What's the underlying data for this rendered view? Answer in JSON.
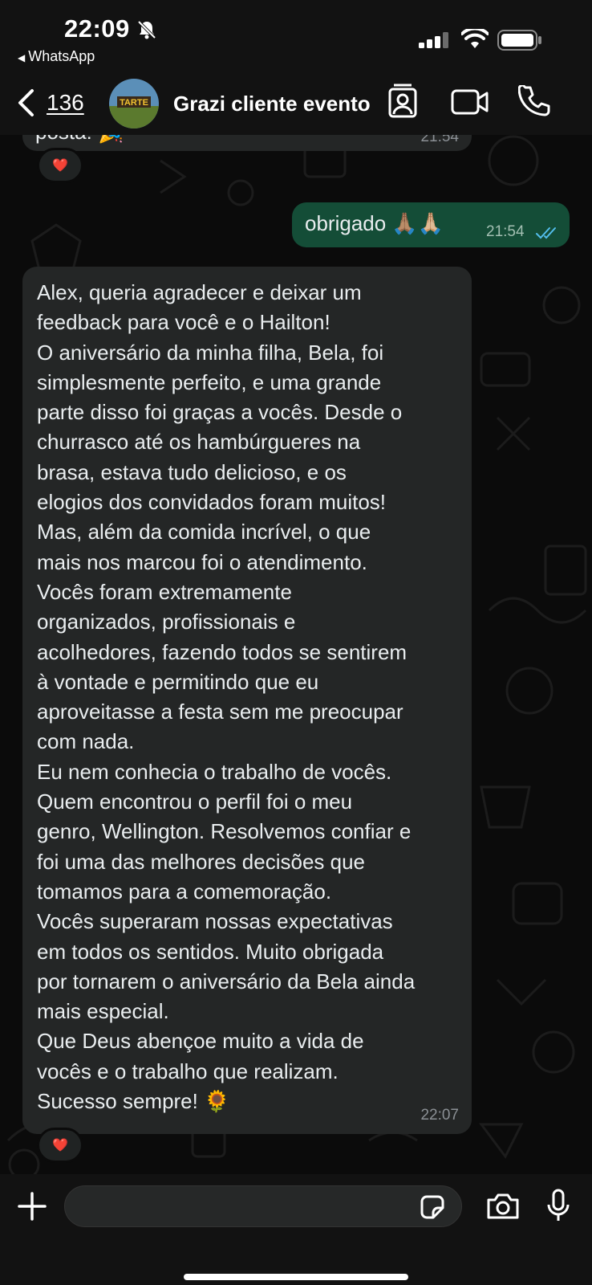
{
  "status_bar": {
    "time": "22:09",
    "back_app_label": "WhatsApp"
  },
  "header": {
    "back_count": "136",
    "contact_name": "Grazi cliente evento",
    "avatar_text": "TARTE"
  },
  "messages": [
    {
      "direction": "incoming",
      "text": "posta! 🎉",
      "time": "21:54",
      "reaction": "❤️"
    },
    {
      "direction": "outgoing",
      "text": "obrigado 🙏🏽🙏🏼",
      "time": "21:54",
      "status": "read"
    },
    {
      "direction": "incoming",
      "text": "Alex, queria agradecer e deixar um\nfeedback para você e o Hailton!\nO aniversário da minha filha, Bela, foi\nsimplesmente perfeito, e uma grande\nparte disso foi graças a vocês. Desde o\nchurrasco até os hambúrgueres na\nbrasa, estava tudo delicioso, e os\nelogios dos convidados foram muitos!\nMas, além da comida incrível, o que\nmais nos marcou foi o atendimento.\nVocês foram extremamente\norganizados, profissionais e\nacolhedores, fazendo todos se sentirem\nà vontade e permitindo que eu\naproveitasse a festa sem me preocupar\ncom nada.\nEu nem conhecia o trabalho de vocês.\nQuem encontrou o perfil foi o meu\ngenro, Wellington. Resolvemos confiar e\nfoi uma das melhores decisões que\ntomamos para a comemoração.\nVocês superaram nossas expectativas\nem todos os sentidos. Muito obrigada\npor tornarem o aniversário da Bela ainda\nmais especial.\nQue Deus abençoe muito a vida de\nvocês e o trabalho que realizam.\nSucesso sempre! 🌻",
      "time": "22:07",
      "reaction": "❤️"
    }
  ],
  "colors": {
    "background": "#0b0b0b",
    "incoming_bubble": "#242626",
    "outgoing_bubble": "#144d37",
    "read_ticks": "#53bdeb"
  }
}
